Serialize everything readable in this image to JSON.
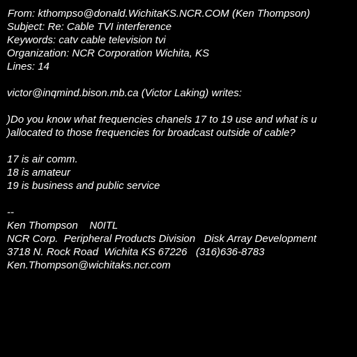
{
  "header": {
    "from": "From: kthompso@donald.WichitaKS.NCR.COM (Ken Thompson)",
    "subject": "Subject: Re: Cable TVI interference",
    "keywords": "Keywords: catv cable television tvi",
    "organization": "Organization: NCR Corporation Wichita, KS",
    "lines": "Lines: 14"
  },
  "attribution": "victor@inqmind.bison.mb.ca (Victor Laking) writes:",
  "quoted": [
    ")Do you know what frequencies chanels 17 to 19 use and what is u",
    ")allocated to those frequencies for broadcast outside of cable?"
  ],
  "reply": [
    "17 is air comm.",
    "18 is amateur",
    "19 is business and public service"
  ],
  "signature": {
    "separator": "--",
    "name_line": "Ken Thompson    N0ITL",
    "company_line": "NCR Corp.  Peripheral Products Division   Disk Array Development",
    "address_line": "3718 N. Rock Road  Wichita KS 67226   (316)636-8783",
    "email_line": "Ken.Thompson@wichitaks.ncr.com"
  },
  "colors": {
    "background": "#000000",
    "text": "#ffffff"
  }
}
